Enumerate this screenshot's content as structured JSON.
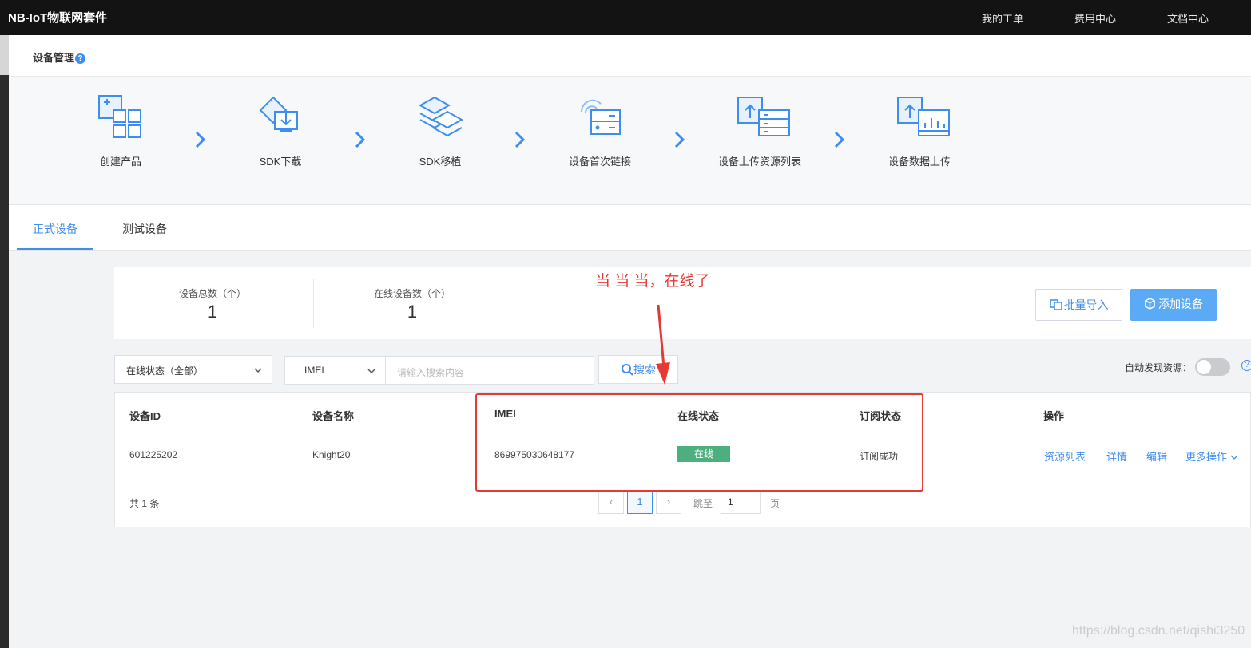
{
  "topbar": {
    "brand": "NB-IoT物联网套件",
    "nav": [
      "我的工单",
      "费用中心",
      "文档中心"
    ]
  },
  "header": {
    "title": "设备管理",
    "help_icon": "?"
  },
  "steps": [
    {
      "label": "创建产品",
      "icon": "create-product-icon"
    },
    {
      "label": "SDK下载",
      "icon": "sdk-download-icon"
    },
    {
      "label": "SDK移植",
      "icon": "sdk-port-icon"
    },
    {
      "label": "设备首次链接",
      "icon": "device-connect-icon"
    },
    {
      "label": "设备上传资源列表",
      "icon": "upload-resource-icon"
    },
    {
      "label": "设备数据上传",
      "icon": "data-upload-icon"
    }
  ],
  "tabs": [
    {
      "label": "正式设备",
      "active": true
    },
    {
      "label": "测试设备",
      "active": false
    }
  ],
  "stats": [
    {
      "label": "设备总数（个）",
      "value": "1"
    },
    {
      "label": "在线设备数（个）",
      "value": "1"
    }
  ],
  "actions": {
    "import_label": "批量导入",
    "add_label": "添加设备"
  },
  "filters": {
    "status_select": "在线状态（全部）",
    "field_select": "IMEI",
    "search_placeholder": "请输入搜索内容",
    "search_label": "搜索",
    "auto_discover_label": "自动发现资源：",
    "auto_discover_on": false
  },
  "table": {
    "columns": [
      "设备ID",
      "设备名称",
      "IMEI",
      "在线状态",
      "订阅状态",
      "操作"
    ],
    "rows": [
      {
        "id": "601225202",
        "name": "Knight20",
        "imei": "869975030648177",
        "status": "在线",
        "subscription": "订阅成功",
        "ops": [
          "资源列表",
          "详情",
          "编辑",
          "更多操作"
        ]
      }
    ]
  },
  "pagination": {
    "total_text": "共 1 条",
    "prev": "‹",
    "current": "1",
    "next": "›",
    "jump_label": "跳至",
    "jump_value": "1",
    "page_suffix": "页"
  },
  "annotation": {
    "text": "当  当  当，在线了"
  },
  "watermark": "https://blog.csdn.net/qishi3250",
  "colors": {
    "accent": "#3d8ef0",
    "online_badge": "#4caf7d",
    "annotation": "#e53935",
    "topbar": "#131313"
  }
}
